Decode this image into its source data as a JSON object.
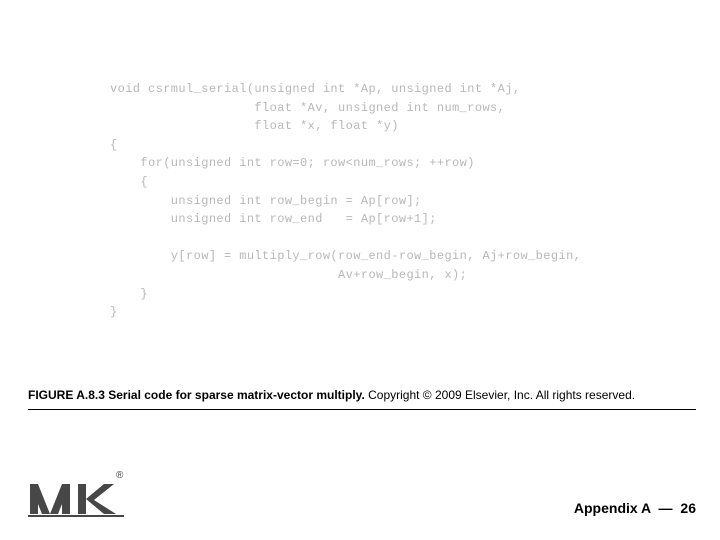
{
  "code": {
    "line1": "void csrmul_serial(unsigned int *Ap, unsigned int *Aj,",
    "line2": "                   float *Av, unsigned int num_rows,",
    "line3": "                   float *x, float *y)",
    "line4": "{",
    "line5": "    for(unsigned int row=0; row<num_rows; ++row)",
    "line6": "    {",
    "line7": "        unsigned int row_begin = Ap[row];",
    "line8": "        unsigned int row_end   = Ap[row+1];",
    "line9": "",
    "line10": "        y[row] = multiply_row(row_end-row_begin, Aj+row_begin,",
    "line11": "                              Av+row_begin, x);",
    "line12": "    }",
    "line13": "}"
  },
  "caption": {
    "figure_label": "FIGURE A.8.3 Serial code for sparse matrix-vector multiply.",
    "copyright": " Copyright © 2009 Elsevier, Inc. All rights reserved."
  },
  "footer": {
    "appendix": "Appendix A",
    "dash": "—",
    "page": "26"
  },
  "logo": {
    "name": "mk-logo",
    "letters": "MK",
    "reg": "®"
  }
}
